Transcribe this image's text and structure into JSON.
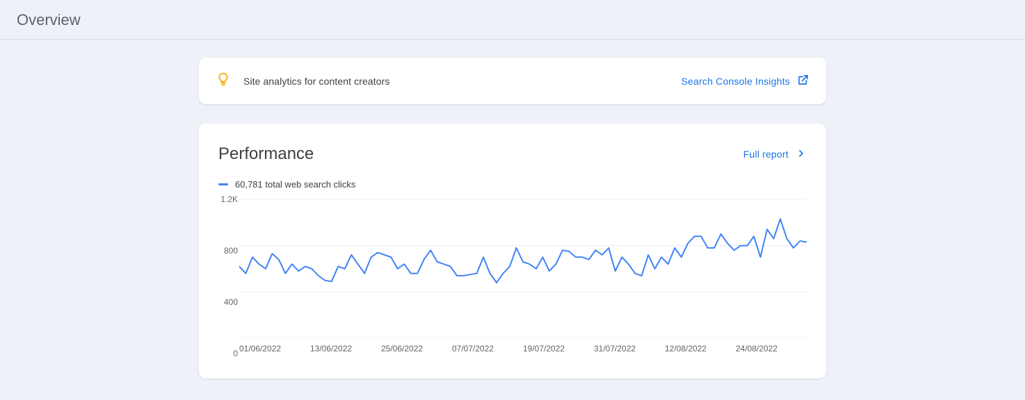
{
  "header": {
    "title": "Overview"
  },
  "insight_card": {
    "text": "Site analytics for content creators",
    "link_label": "Search Console Insights"
  },
  "performance": {
    "title": "Performance",
    "full_report_label": "Full report",
    "legend_label": "60,781 total web search clicks"
  },
  "chart_data": {
    "type": "line",
    "title": "Performance",
    "xlabel": "",
    "ylabel": "",
    "ylim": [
      0,
      1200
    ],
    "y_ticks": [
      "0",
      "400",
      "800",
      "1.2K"
    ],
    "categories": [
      "01/06/2022",
      "13/06/2022",
      "25/06/2022",
      "07/07/2022",
      "19/07/2022",
      "31/07/2022",
      "12/08/2022",
      "24/08/2022"
    ],
    "series": [
      {
        "name": "total web search clicks",
        "color": "#4285f4",
        "values": [
          620,
          560,
          700,
          640,
          600,
          730,
          680,
          560,
          640,
          580,
          620,
          600,
          540,
          500,
          490,
          620,
          600,
          720,
          640,
          560,
          700,
          740,
          720,
          700,
          600,
          640,
          560,
          560,
          680,
          760,
          660,
          640,
          620,
          540,
          540,
          550,
          560,
          700,
          560,
          480,
          560,
          620,
          780,
          660,
          640,
          600,
          700,
          580,
          640,
          760,
          750,
          700,
          700,
          680,
          760,
          720,
          780,
          580,
          700,
          640,
          560,
          540,
          720,
          600,
          700,
          640,
          780,
          700,
          820,
          880,
          880,
          780,
          780,
          900,
          820,
          760,
          800,
          800,
          880,
          700,
          940,
          860,
          1030,
          860,
          780,
          840,
          830
        ]
      }
    ]
  }
}
